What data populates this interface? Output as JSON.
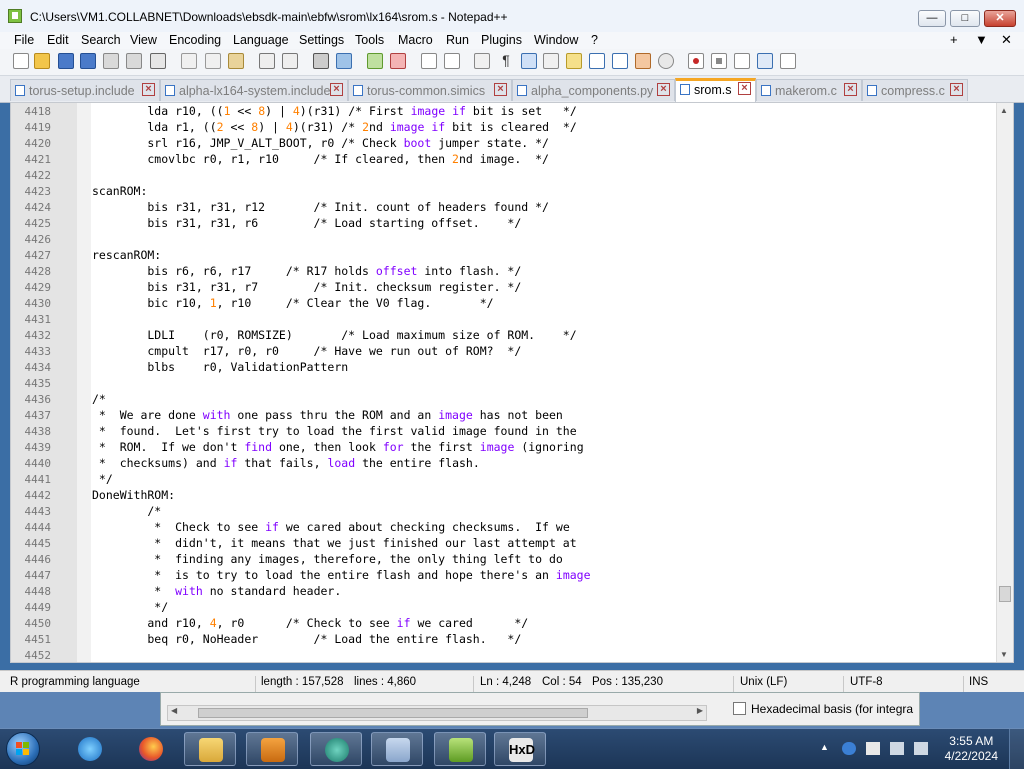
{
  "window": {
    "title": "C:\\Users\\VM1.COLLABNET\\Downloads\\ebsdk-main\\ebfw\\srom\\lx164\\srom.s - Notepad++",
    "min_label": "—",
    "max_label": "□",
    "close_label": "✕"
  },
  "menu": {
    "items": [
      "File",
      "Edit",
      "Search",
      "View",
      "Encoding",
      "Language",
      "Settings",
      "Tools",
      "Macro",
      "Run",
      "Plugins",
      "Window",
      "?"
    ],
    "right": [
      "+",
      "▼",
      "✕"
    ]
  },
  "tabs": [
    {
      "label": "torus-setup.include",
      "active": false
    },
    {
      "label": "alpha-lx164-system.include",
      "active": false
    },
    {
      "label": "torus-common.simics",
      "active": false
    },
    {
      "label": "alpha_components.py",
      "active": false
    },
    {
      "label": "srom.s",
      "active": true
    },
    {
      "label": "makerom.c",
      "active": false
    },
    {
      "label": "compress.c",
      "active": false
    }
  ],
  "editor": {
    "lines": [
      {
        "n": "4418",
        "segs": [
          [
            "        lda r10, ((",
            ""
          ],
          [
            "1",
            "num"
          ],
          [
            " << ",
            ""
          ],
          [
            "8",
            "num"
          ],
          [
            ") | ",
            ""
          ],
          [
            "4",
            "num"
          ],
          [
            ")(r31) /* First ",
            ""
          ],
          [
            "image",
            "kw"
          ],
          [
            " ",
            ""
          ],
          [
            "if",
            "kw"
          ],
          [
            " bit is set   */",
            ""
          ]
        ]
      },
      {
        "n": "4419",
        "segs": [
          [
            "        lda r1, ((",
            ""
          ],
          [
            "2",
            "num"
          ],
          [
            " << ",
            ""
          ],
          [
            "8",
            "num"
          ],
          [
            ") | ",
            ""
          ],
          [
            "4",
            "num"
          ],
          [
            ")(r31) /* ",
            ""
          ],
          [
            "2",
            "num"
          ],
          [
            "nd ",
            ""
          ],
          [
            "image",
            "kw"
          ],
          [
            " ",
            ""
          ],
          [
            "if",
            "kw"
          ],
          [
            " bit is cleared  */",
            ""
          ]
        ]
      },
      {
        "n": "4420",
        "segs": [
          [
            "        srl r16, JMP_V_ALT_BOOT, r0 /* Check ",
            ""
          ],
          [
            "boot",
            "kw"
          ],
          [
            " jumper state. */",
            ""
          ]
        ]
      },
      {
        "n": "4421",
        "segs": [
          [
            "        cmovlbc r0, r1, r10     /* If cleared, then ",
            ""
          ],
          [
            "2",
            "num"
          ],
          [
            "nd image.  */",
            ""
          ]
        ]
      },
      {
        "n": "4422",
        "segs": [
          [
            "",
            ""
          ]
        ]
      },
      {
        "n": "4423",
        "segs": [
          [
            "scanROM:",
            ""
          ]
        ]
      },
      {
        "n": "4424",
        "segs": [
          [
            "        bis r31, r31, r12       /* Init. count of headers found */",
            ""
          ]
        ]
      },
      {
        "n": "4425",
        "segs": [
          [
            "        bis r31, r31, r6        /* Load starting offset.    */",
            ""
          ]
        ]
      },
      {
        "n": "4426",
        "segs": [
          [
            "",
            ""
          ]
        ]
      },
      {
        "n": "4427",
        "segs": [
          [
            "rescanROM:",
            ""
          ]
        ]
      },
      {
        "n": "4428",
        "segs": [
          [
            "        bis r6, r6, r17     /* R17 holds ",
            ""
          ],
          [
            "offset",
            "kw"
          ],
          [
            " into flash. */",
            ""
          ]
        ]
      },
      {
        "n": "4429",
        "segs": [
          [
            "        bis r31, r31, r7        /* Init. checksum register. */",
            ""
          ]
        ]
      },
      {
        "n": "4430",
        "segs": [
          [
            "        bic r10, ",
            ""
          ],
          [
            "1",
            "num"
          ],
          [
            ", r10     /* Clear the V0 flag.       */",
            ""
          ]
        ]
      },
      {
        "n": "4431",
        "segs": [
          [
            "",
            ""
          ]
        ]
      },
      {
        "n": "4432",
        "segs": [
          [
            "        LDLI    (r0, ROMSIZE)       /* Load maximum size of ROM.    */",
            ""
          ]
        ]
      },
      {
        "n": "4433",
        "segs": [
          [
            "        cmpult  r17, r0, r0     /* Have we run out of ROM?  */",
            ""
          ]
        ]
      },
      {
        "n": "4434",
        "segs": [
          [
            "        blbs    r0, ValidationPattern",
            ""
          ]
        ]
      },
      {
        "n": "4435",
        "segs": [
          [
            "",
            ""
          ]
        ]
      },
      {
        "n": "4436",
        "segs": [
          [
            "/*",
            ""
          ]
        ]
      },
      {
        "n": "4437",
        "segs": [
          [
            " *  We are done ",
            ""
          ],
          [
            "with",
            "kw"
          ],
          [
            " one pass thru the ROM and an ",
            ""
          ],
          [
            "image",
            "kw"
          ],
          [
            " has not been",
            ""
          ]
        ]
      },
      {
        "n": "4438",
        "segs": [
          [
            " *  found.  Let's first try to load the first valid image found in the",
            ""
          ]
        ]
      },
      {
        "n": "4439",
        "segs": [
          [
            " *  ROM.  If we don't ",
            ""
          ],
          [
            "find",
            "kw"
          ],
          [
            " one, then look ",
            ""
          ],
          [
            "for",
            "kw"
          ],
          [
            " the first ",
            ""
          ],
          [
            "image",
            "kw"
          ],
          [
            " (ignoring",
            ""
          ]
        ]
      },
      {
        "n": "4440",
        "segs": [
          [
            " *  checksums) and ",
            ""
          ],
          [
            "if",
            "kw"
          ],
          [
            " that fails, ",
            ""
          ],
          [
            "load",
            "kw"
          ],
          [
            " the entire flash.",
            ""
          ]
        ]
      },
      {
        "n": "4441",
        "segs": [
          [
            " */",
            ""
          ]
        ]
      },
      {
        "n": "4442",
        "segs": [
          [
            "DoneWithROM:",
            ""
          ]
        ]
      },
      {
        "n": "4443",
        "segs": [
          [
            "        /*",
            ""
          ]
        ]
      },
      {
        "n": "4444",
        "segs": [
          [
            "         *  Check to see ",
            ""
          ],
          [
            "if",
            "kw"
          ],
          [
            " we cared about checking checksums.  If we",
            ""
          ]
        ]
      },
      {
        "n": "4445",
        "segs": [
          [
            "         *  didn't, it means that we just finished our last attempt at",
            ""
          ]
        ]
      },
      {
        "n": "4446",
        "segs": [
          [
            "         *  finding any images, therefore, the only thing left to do",
            ""
          ]
        ]
      },
      {
        "n": "4447",
        "segs": [
          [
            "         *  is to try to load the entire flash and hope there's an ",
            ""
          ],
          [
            "image",
            "kw"
          ]
        ]
      },
      {
        "n": "4448",
        "segs": [
          [
            "         *  ",
            ""
          ],
          [
            "with",
            "kw"
          ],
          [
            " no standard header.",
            ""
          ]
        ]
      },
      {
        "n": "4449",
        "segs": [
          [
            "         */",
            ""
          ]
        ]
      },
      {
        "n": "4450",
        "segs": [
          [
            "        and r10, ",
            ""
          ],
          [
            "4",
            "num"
          ],
          [
            ", r0      /* Check to see ",
            ""
          ],
          [
            "if",
            "kw"
          ],
          [
            " we cared      */",
            ""
          ]
        ]
      },
      {
        "n": "4451",
        "segs": [
          [
            "        beq r0, NoHeader        /* Load the entire flash.   */",
            ""
          ]
        ]
      },
      {
        "n": "4452",
        "segs": [
          [
            "",
            ""
          ]
        ]
      }
    ]
  },
  "status": {
    "language": "R programming language",
    "length": "length : 157,528",
    "lines": "lines : 4,860",
    "ln": "Ln : 4,248",
    "col": "Col : 54",
    "pos": "Pos : 135,230",
    "eol": "Unix (LF)",
    "encoding": "UTF-8",
    "mode": "INS"
  },
  "background_window": {
    "checkbox_label": "Hexadecimal basis (for integra"
  },
  "taskbar": {
    "apps": [
      "internet-explorer",
      "firefox",
      "file-explorer",
      "media-player",
      "app-5",
      "app-6",
      "notepad-plus-plus",
      "hxd"
    ],
    "time": "3:55 AM",
    "date": "4/22/2024"
  },
  "colors": {
    "keyword": "#8000ff",
    "number": "#ff8000",
    "active_tab_accent": "#f5a623",
    "taskbar": "#1c3556"
  }
}
